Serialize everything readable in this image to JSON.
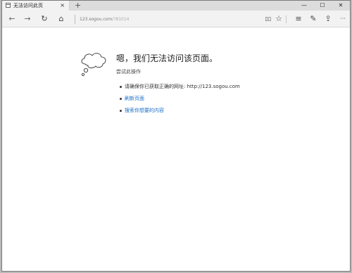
{
  "browser": {
    "tab": {
      "title": "无法访问此页",
      "close_glyph": "×"
    },
    "new_tab_glyph": "+",
    "window_controls": {
      "minimize": "—",
      "maximize": "☐",
      "close": "✕"
    },
    "nav": {
      "back": "←",
      "forward": "→",
      "refresh": "↻",
      "home": "⌂"
    },
    "address": {
      "host": "123.sogou.com",
      "path": "/?81014"
    },
    "toolbar": {
      "reading_view": "▯▯",
      "favorite": "☆",
      "hub": "≡",
      "web_note": "✎",
      "share": "⇪",
      "more": "···"
    }
  },
  "error_page": {
    "heading": "嗯，我们无法访问该页面。",
    "subheading": "尝试此操作",
    "items": [
      {
        "text": "请确保你已获取正确的网址: http://123.sogou.com",
        "link": false
      },
      {
        "text": "刷新页面",
        "link": true
      },
      {
        "text": "搜索你想要的内容",
        "link": true
      }
    ]
  },
  "colors": {
    "link": "#1a6fc7",
    "tab_strip": "#dcdcdc",
    "nav_bar": "#f2f2f2"
  }
}
